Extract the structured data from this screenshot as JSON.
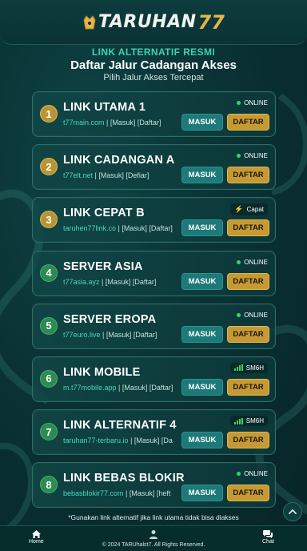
{
  "brand": {
    "name_text": "TARUHAN",
    "name_num": "77"
  },
  "header": {
    "kicker": "LINK ALTERNATIF RESMI",
    "title": "Daftar Jalur Cadangan Akses",
    "subtitle": "Pilih Jalur Akses Tercepat"
  },
  "links": [
    {
      "num": "1",
      "name": "LINK UTAMA 1",
      "domain": "t77main.com",
      "tail": " | [Masuk] [Daftar]",
      "status": "ONLINE",
      "status_icon": "online-dot",
      "badge_color": "#b79535",
      "masuk": "MASUK",
      "daftar": "DAFTAR"
    },
    {
      "num": "2",
      "name": "LINK CADANGAN A",
      "domain": "t77elt.net",
      "tail": " | [Masuk] [Defiar]",
      "status": "ONLINE",
      "status_icon": "online-dot",
      "badge_color": "#b79535",
      "masuk": "MASUK",
      "daftar": "DAFTAR"
    },
    {
      "num": "3",
      "name": "LINK CEPAT B",
      "domain": "taruhen77link.co",
      "tail": " | [Masuk] [Daftar]",
      "status": "Capat",
      "status_icon": "bolt-icon",
      "badge_color": "#b79535",
      "masuk": "MASUK",
      "daftar": "DAFTAR"
    },
    {
      "num": "4",
      "name": "SERVER ASIA",
      "domain": "t77asia.ayz",
      "tail": " | [Masuk] [Daftar]",
      "status": "ONLINE",
      "status_icon": "online-dot",
      "badge_color": "#2c8a52",
      "masuk": "MASUK",
      "daftar": "DAFTAR"
    },
    {
      "num": "5",
      "name": "SERVER EROPA",
      "domain": "t77euro.live",
      "tail": " | [Masuk] [Daftar]",
      "status": "ONLINE",
      "status_icon": "online-dot",
      "badge_color": "#2c8a52",
      "masuk": "MASUK",
      "daftar": "DAFTAR"
    },
    {
      "num": "6",
      "name": "LINK MOBILE",
      "domain": "m.t77mobile.app",
      "tail": " | [Masuk] [Daftar]",
      "status": "SM6H",
      "status_icon": "signal-icon",
      "badge_color": "#2c8a52",
      "masuk": "MASUK",
      "daftar": "DAFTAR"
    },
    {
      "num": "7",
      "name": "LINK ALTERNATIF 4",
      "domain": "taruhan77-terbaru.io",
      "tail": " | [Masuk] [Da",
      "status": "SM6H",
      "status_icon": "signal-icon",
      "badge_color": "#2c8a52",
      "masuk": "MASUK",
      "daftar": "DAFTAR"
    },
    {
      "num": "8",
      "name": "LINK BEBAS BLOKIR",
      "domain": "bebasblokir77.com",
      "tail": " | [Masuk] [heft",
      "status": "ONLINE",
      "status_icon": "online-dot",
      "badge_color": "#2c8a52",
      "masuk": "MASUK",
      "daftar": "DAFTAR"
    }
  ],
  "footnote": "*Gunakan link alternatif jika link utama tidak bisa diakses",
  "footer": {
    "home_label": "Home",
    "chat_label": "Chat",
    "copyright": "© 2024 TARUhalst7. All Rights Reserved."
  },
  "colors": {
    "accent_teal": "#3fd0b4",
    "gold": "#c59a35",
    "online_green": "#39d36a",
    "masuk_button": "#1d7a78"
  }
}
